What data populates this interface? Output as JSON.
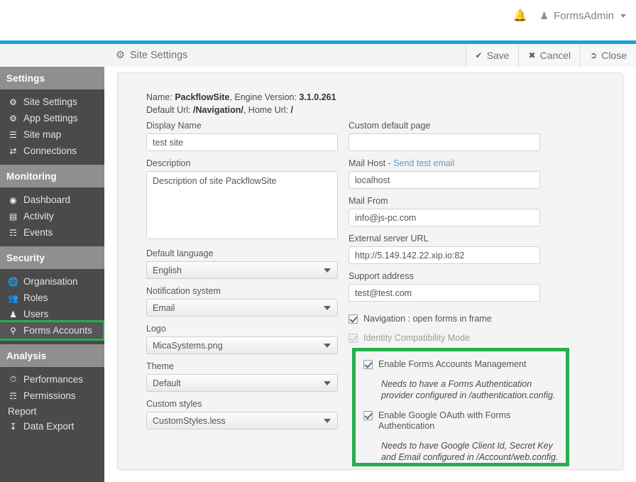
{
  "header": {
    "bell_icon": "bell-icon",
    "user_icon": "user-icon",
    "user_name": "FormsAdmin",
    "caret_icon": "chevron-down-icon"
  },
  "toolbar": {
    "title_icon": "gears-icon",
    "title": "Site Settings",
    "save_label": "Save",
    "save_icon": "check-icon",
    "cancel_label": "Cancel",
    "cancel_icon": "times-icon",
    "close_label": "Close",
    "close_icon": "sign-out-icon"
  },
  "sidebar": {
    "groups": [
      {
        "header": "Settings",
        "items": [
          {
            "label": "Site Settings",
            "icon": "gears-icon",
            "selected": false
          },
          {
            "label": "App Settings",
            "icon": "gears-icon",
            "selected": false
          },
          {
            "label": "Site map",
            "icon": "sitemap-icon",
            "selected": false
          },
          {
            "label": "Connections",
            "icon": "exchange-icon",
            "selected": false
          }
        ]
      },
      {
        "header": "Monitoring",
        "items": [
          {
            "label": "Dashboard",
            "icon": "dashboard-icon",
            "selected": false
          },
          {
            "label": "Activity",
            "icon": "bar-chart-icon",
            "selected": false
          },
          {
            "label": "Events",
            "icon": "list-icon",
            "selected": false
          }
        ]
      },
      {
        "header": "Security",
        "items": [
          {
            "label": "Organisation",
            "icon": "globe-icon",
            "selected": false
          },
          {
            "label": "Roles",
            "icon": "users-icon",
            "selected": false
          },
          {
            "label": "Users",
            "icon": "user-icon",
            "selected": false
          },
          {
            "label": "Forms Accounts",
            "icon": "key-icon",
            "selected": true
          }
        ]
      },
      {
        "header": "Analysis",
        "items": [
          {
            "label": "Performances",
            "icon": "clock-icon",
            "selected": false
          },
          {
            "label": "Permissions",
            "icon": "list-icon",
            "selected": false
          },
          {
            "label": "Report",
            "icon": "",
            "selected": false
          },
          {
            "label": "Data Export",
            "icon": "download-icon",
            "selected": false
          }
        ]
      }
    ]
  },
  "panel": {
    "meta": {
      "name_label": "Name:",
      "name_value": "PackflowSite",
      "engine_label": ", Engine Version:",
      "engine_value": "3.1.0.261",
      "default_url_label": "Default Url:",
      "default_url_value": "/Navigation/",
      "home_url_label": ", Home Url:",
      "home_url_value": "/"
    },
    "left": {
      "display_name_label": "Display Name",
      "display_name_value": "test site",
      "display_name_placeholder": "",
      "description_label": "Description",
      "description_value": "Description of site PackflowSite",
      "description_placeholder": "",
      "default_language_label": "Default language",
      "default_language_value": "English",
      "notification_system_label": "Notification system",
      "notification_system_value": "Email",
      "logo_label": "Logo",
      "logo_value": "MicaSystems.png",
      "theme_label": "Theme",
      "theme_value": "Default",
      "custom_styles_label": "Custom styles",
      "custom_styles_value": "CustomStyles.less"
    },
    "right": {
      "custom_default_page_label": "Custom default page",
      "custom_default_page_value": "",
      "custom_default_page_placeholder": "",
      "mail_host_label": "Mail Host - ",
      "mail_host_link": "Send test email",
      "mail_host_value": "localhost",
      "mail_from_label": "Mail From",
      "mail_from_value": "info@js-pc.com",
      "external_server_url_label": "External server URL",
      "external_server_url_value": "http://5.149.142.22.xip.io:82",
      "support_address_label": "Support address",
      "support_address_value": "test@test.com",
      "checkboxes": [
        {
          "label": "Navigation : open forms in frame",
          "checked": true,
          "disabled": false
        },
        {
          "label": "Identity Compatibility Mode",
          "checked": true,
          "disabled": true
        }
      ],
      "highlighted_box": {
        "forms_accounts_label": "Enable Forms Accounts Management",
        "forms_accounts_checked": true,
        "forms_accounts_hint_line1": "Needs to have a Forms Authentication",
        "forms_accounts_hint_line2": "provider configured in /authentication.config.",
        "google_oauth_label": "Enable Google OAuth with Forms Authentication",
        "google_oauth_checked": true,
        "google_oauth_hint_line1": "Needs to have Google Client Id, Secret Key",
        "google_oauth_hint_line2": "and Email configured in /Account/web.config."
      }
    }
  },
  "colors": {
    "accent_blue": "#16a5d9",
    "highlight_green": "#27ae4d",
    "sidebar_bg": "#4a4a4a",
    "sidebar_header_bg": "#8f8f8f",
    "panel_bg": "#f4f4f4",
    "link_blue": "#5b9bd5"
  }
}
